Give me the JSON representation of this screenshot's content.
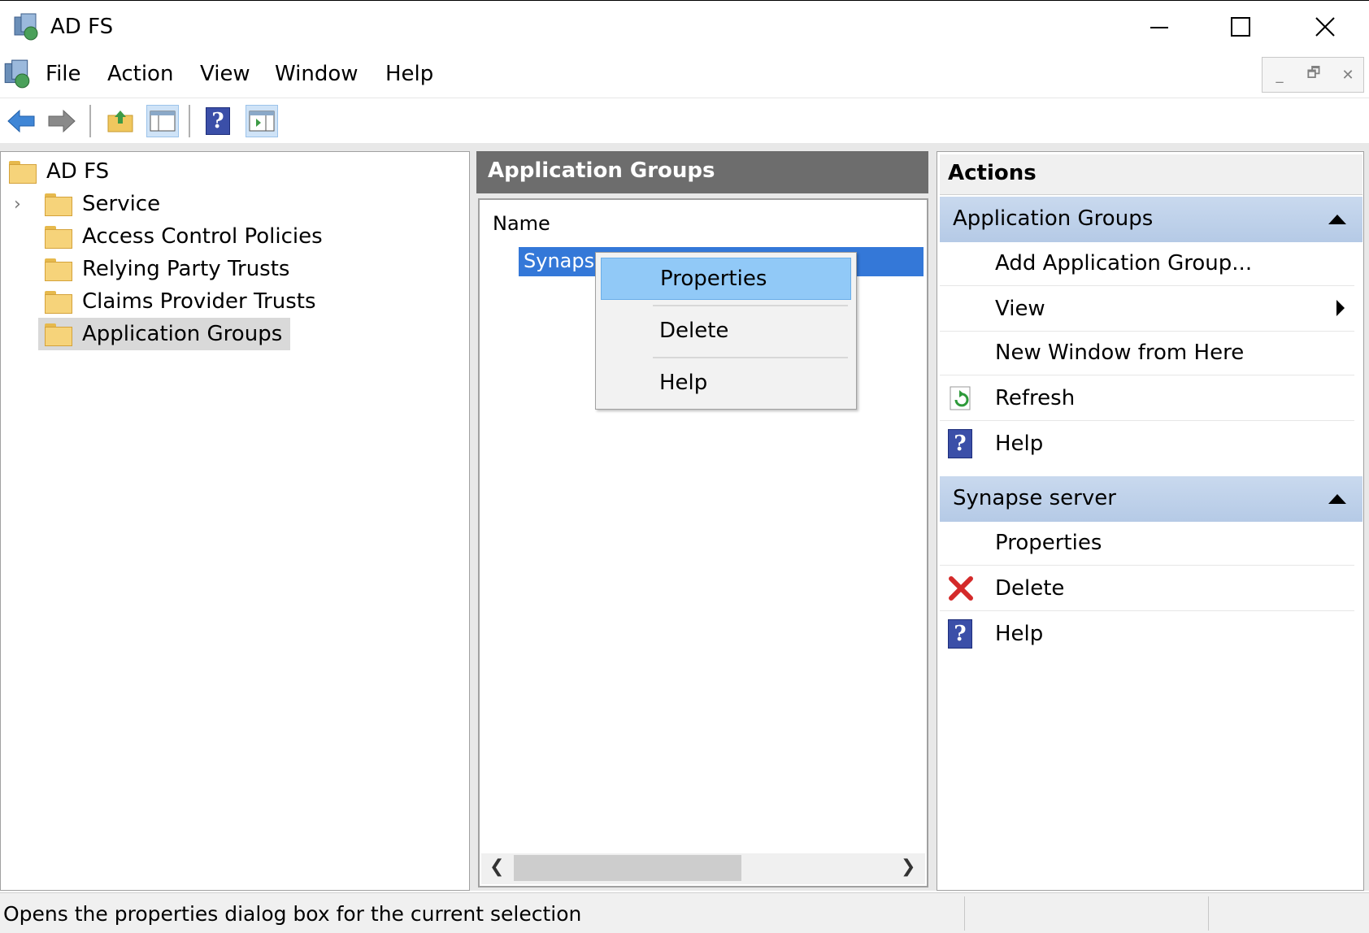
{
  "window": {
    "title": "AD FS"
  },
  "menu": [
    "File",
    "Action",
    "View",
    "Window",
    "Help"
  ],
  "tree": {
    "root": "AD FS",
    "items": [
      "Service",
      "Access Control Policies",
      "Relying Party Trusts",
      "Claims Provider Trusts",
      "Application Groups"
    ],
    "selected": "Application Groups"
  },
  "middle": {
    "header": "Application Groups",
    "column": "Name",
    "selected_row": "Synapse"
  },
  "context_menu": [
    "Properties",
    "Delete",
    "Help"
  ],
  "actions": {
    "title": "Actions",
    "section1": {
      "title": "Application Groups",
      "items": [
        "Add Application Group...",
        "View",
        "New Window from Here",
        "Refresh",
        "Help"
      ]
    },
    "section2": {
      "title": "Synapse server",
      "items": [
        "Properties",
        "Delete",
        "Help"
      ]
    }
  },
  "status": "Opens the properties dialog box for the current selection",
  "colors": {
    "selection": "#3478d8",
    "menu_highlight": "#91c9f7",
    "section_bg": "#c0d3ec",
    "pane_header": "#6d6d6d"
  },
  "icons": [
    "adfs-icon",
    "back-arrow-icon",
    "forward-arrow-icon",
    "up-folder-icon",
    "show-hide-tree-icon",
    "help-icon",
    "show-hide-action-pane-icon",
    "folder-icon",
    "refresh-icon",
    "delete-icon"
  ]
}
